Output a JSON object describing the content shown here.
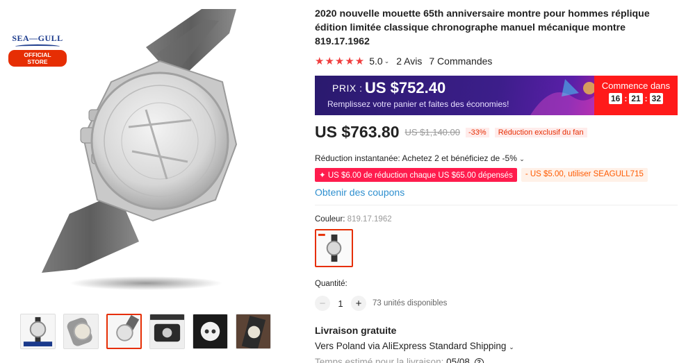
{
  "brand": {
    "name": "SEA—GULL",
    "badge": "OFFICIAL STORE"
  },
  "product": {
    "title": "2020 nouvelle mouette 65th anniversaire montre pour hommes réplique édition limitée classique chronographe manuel mécanique montre 819.17.1962",
    "rating": "5.0",
    "reviews": "2 Avis",
    "orders": "7 Commandes"
  },
  "promo": {
    "label": "PRIX :",
    "price": "US $752.40",
    "subtitle": "Remplissez votre panier et faites des économies!",
    "countdown_label": "Commence dans",
    "hours": "16",
    "minutes": "21",
    "seconds": "32"
  },
  "pricing": {
    "price": "US $763.80",
    "original": "US $1,140.00",
    "discount": "-33%",
    "fan_discount": "Réduction exclusif du fan"
  },
  "offers": {
    "instant": "Réduction instantanée: Achetez 2 et bénéficiez de -5%",
    "coupon_store": "US $6.00 de réduction chaque US $65.00 dépensés",
    "coupon_code": "- US $5.00, utiliser SEAGULL715",
    "coupons_link": "Obtenir des coupons"
  },
  "color": {
    "label": "Couleur:",
    "value": "819.17.1962"
  },
  "quantity": {
    "label": "Quantité:",
    "value": "1",
    "stock": "73 unités disponibles"
  },
  "shipping": {
    "title": "Livraison gratuite",
    "line": "Vers Poland via AliExpress Standard Shipping",
    "estimate_label": "Temps estimé pour la livraison:",
    "estimate_date": "05/08"
  },
  "colors": {
    "accent": "#e62e04",
    "link": "#2e8fcf",
    "promo_red": "#ff1a1a"
  },
  "icons": {
    "star": "star-icon",
    "chevron": "chevron-down-icon",
    "help": "help-circle-icon",
    "plus": "plus-icon",
    "minus": "minus-icon"
  }
}
